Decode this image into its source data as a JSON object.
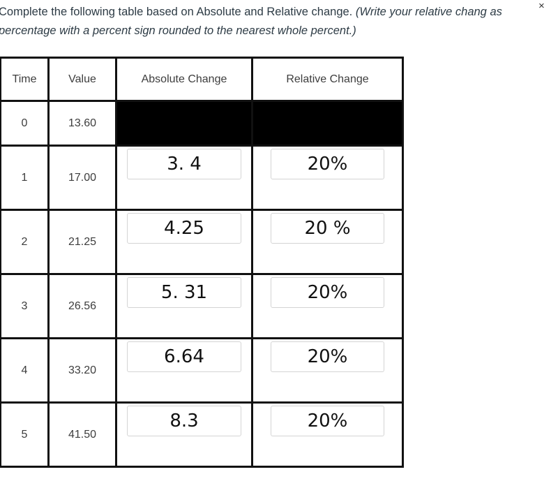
{
  "instructions": {
    "main": "Complete the following table based on Absolute and Relative change.",
    "italic": "(Write your relative change as a percentage with a percent sign rounded to the nearest whole percent.)",
    "line1_plain": "Complete the following table based on Absolute and Relative change. ",
    "line1_italic": "(Write your relative chang",
    "line1_tail": " as",
    "line2_italic": "percentage with a percent sign rounded to the nearest whole percent.)"
  },
  "close_icon": "×",
  "table": {
    "headers": [
      "Time",
      "Value",
      "Absolute Change",
      "Relative Change"
    ],
    "rows": [
      {
        "time": "0",
        "value": "13.60",
        "absolute_change": null,
        "relative_change": null
      },
      {
        "time": "1",
        "value": "17.00",
        "absolute_change": "3. 4",
        "relative_change": "20%"
      },
      {
        "time": "2",
        "value": "21.25",
        "absolute_change": "4.25",
        "relative_change": "20 %"
      },
      {
        "time": "3",
        "value": "26.56",
        "absolute_change": "5. 31",
        "relative_change": "20%"
      },
      {
        "time": "4",
        "value": "33.20",
        "absolute_change": "6.64",
        "relative_change": "20%"
      },
      {
        "time": "5",
        "value": "41.50",
        "absolute_change": "8.3",
        "relative_change": "20%"
      }
    ]
  }
}
